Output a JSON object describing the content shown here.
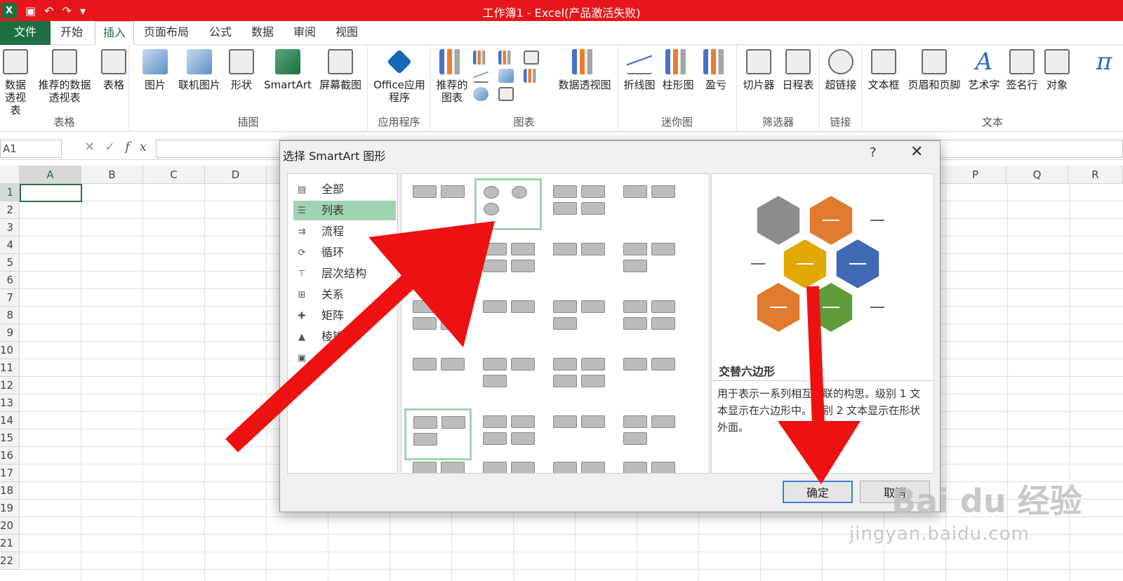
{
  "window": {
    "title": "工作簿1 - Excel(产品激活失败)",
    "app_logo": "X"
  },
  "ribbon_tabs": [
    "文件",
    "开始",
    "插入",
    "页面布局",
    "公式",
    "数据",
    "审阅",
    "视图"
  ],
  "ribbon": {
    "groups": [
      {
        "label": "表格",
        "buttons": [
          "数据透视表",
          "推荐的数据透视表",
          "表格"
        ]
      },
      {
        "label": "插图",
        "buttons": [
          "图片",
          "联机图片",
          "形状",
          "SmartArt",
          "屏幕截图"
        ]
      },
      {
        "label": "应用程序",
        "buttons": [
          "Office应用程序"
        ]
      },
      {
        "label": "图表",
        "buttons": [
          "推荐的图表",
          "数据透视图"
        ]
      },
      {
        "label": "迷你图",
        "buttons": [
          "折线图",
          "柱形图",
          "盈亏"
        ]
      },
      {
        "label": "筛选器",
        "buttons": [
          "切片器",
          "日程表"
        ]
      },
      {
        "label": "链接",
        "buttons": [
          "超链接"
        ]
      },
      {
        "label": "文本",
        "buttons": [
          "文本框",
          "页眉和页脚",
          "艺术字",
          "签名行",
          "对象"
        ]
      }
    ]
  },
  "formula_bar": {
    "name_box": "A1",
    "fx": "fx"
  },
  "grid": {
    "columns": [
      "A",
      "B",
      "C",
      "D",
      "P",
      "Q",
      "R"
    ],
    "rows": [
      "1",
      "2",
      "3",
      "4",
      "5",
      "6",
      "7",
      "8",
      "9",
      "10",
      "11",
      "12",
      "13",
      "14",
      "15",
      "16",
      "17",
      "18",
      "19",
      "20",
      "21",
      "22"
    ]
  },
  "dialog": {
    "title": "选择 SmartArt 图形",
    "help": "?",
    "close": "✕",
    "categories": [
      "全部",
      "列表",
      "流程",
      "循环",
      "层次结构",
      "关系",
      "矩阵",
      "棱锥图"
    ],
    "selected_category": "列表",
    "preview_name": "交替六边形",
    "preview_description": "用于表示一系列相互关联的构思。级别 1 文本显示在六边形中。级别 2 文本显示在形状外面。",
    "ok_label": "确定",
    "cancel_label": "取消",
    "hexagon_colors": [
      "#8c8c8c",
      "#e07a2e",
      "#e0a800",
      "#3f68b5",
      "#e07a2e",
      "#5e9c3a"
    ]
  },
  "watermark": {
    "main": "Bai du 经验",
    "sub": "jingyan.baidu.com"
  },
  "colors": {
    "title_bar": "#e8161a",
    "excel_green": "#1d6f42",
    "selection": "#9fd4b1",
    "arrow_red": "#ee1111"
  }
}
